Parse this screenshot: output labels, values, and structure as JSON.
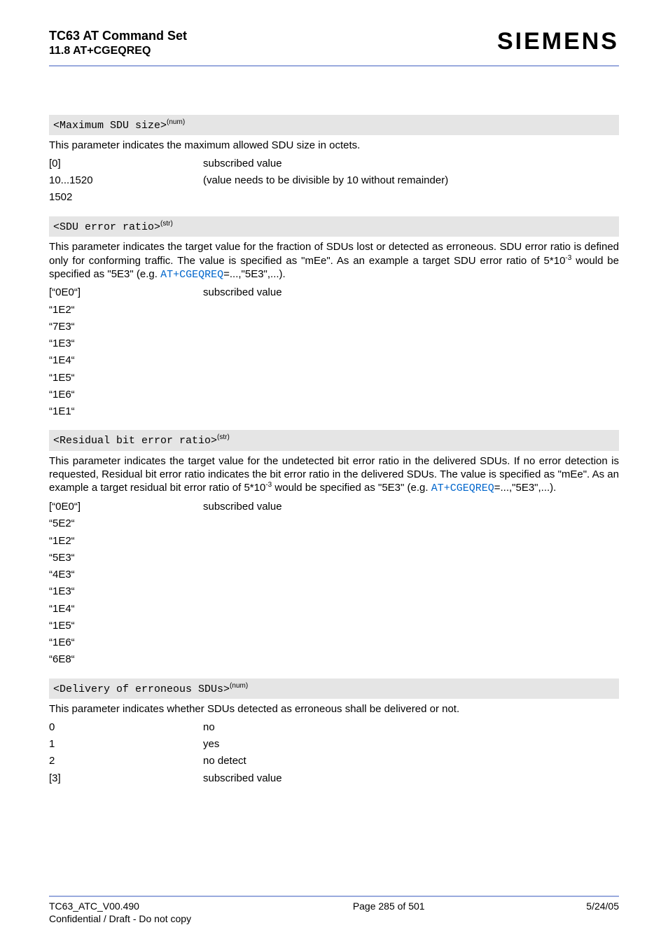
{
  "header": {
    "title": "TC63 AT Command Set",
    "section": "11.8 AT+CGEQREQ",
    "brand": "SIEMENS"
  },
  "sections": [
    {
      "param_html": "<span class=\"mono\">&lt;Maximum SDU size&gt;</span><sup>(num)</sup>",
      "desc_html": "This parameter indicates the maximum allowed SDU size in octets.",
      "rows": [
        {
          "k": "[0]",
          "v": "subscribed value"
        },
        {
          "k": "10...1520",
          "v": "(value needs to be divisible by 10 without remainder)"
        },
        {
          "k": "1502",
          "v": ""
        }
      ]
    },
    {
      "param_html": "<span class=\"mono\">&lt;SDU error ratio&gt;</span><sup>(str)</sup>",
      "desc_html": "This parameter indicates the target value for the fraction of SDUs lost or detected as erroneous. SDU error ratio is defined only for conforming traffic. The value is specified as \"mEe\". As an example a target SDU error ratio of 5*10<sup>-3</sup> would be specified as \"5E3\" (e.g. <span class=\"xref\">AT+CGEQREQ</span>=...,\"5E3\",...).",
      "rows": [
        {
          "k": "[“0E0“]",
          "v": "subscribed value"
        },
        {
          "k": "“1E2“",
          "v": ""
        },
        {
          "k": "“7E3“",
          "v": ""
        },
        {
          "k": "“1E3“",
          "v": ""
        },
        {
          "k": "“1E4“",
          "v": ""
        },
        {
          "k": "“1E5“",
          "v": ""
        },
        {
          "k": "“1E6“",
          "v": ""
        },
        {
          "k": "“1E1“",
          "v": ""
        }
      ]
    },
    {
      "param_html": "<span class=\"mono\">&lt;Residual bit error ratio&gt;</span><sup>(str)</sup>",
      "desc_html": "This parameter indicates the target value for the undetected bit error ratio in the delivered SDUs. If no error detection is requested, Residual bit error ratio indicates the bit error ratio in the delivered SDUs. The value is specified as \"mEe\". As an example a target residual bit error ratio of 5*10<sup>-3</sup> would be specified as \"5E3\" (e.g. <span class=\"xref\">AT+CGEQREQ</span>=...,\"5E3\",...).",
      "rows": [
        {
          "k": "[“0E0“]",
          "v": "subscribed value"
        },
        {
          "k": "“5E2“",
          "v": ""
        },
        {
          "k": "“1E2“",
          "v": ""
        },
        {
          "k": "“5E3“",
          "v": ""
        },
        {
          "k": "“4E3“",
          "v": ""
        },
        {
          "k": "“1E3“",
          "v": ""
        },
        {
          "k": "“1E4“",
          "v": ""
        },
        {
          "k": "“1E5“",
          "v": ""
        },
        {
          "k": "“1E6“",
          "v": ""
        },
        {
          "k": "“6E8“",
          "v": ""
        }
      ]
    },
    {
      "param_html": "<span class=\"mono\">&lt;Delivery of erroneous SDUs&gt;</span><sup>(num)</sup>",
      "desc_html": "This parameter indicates whether SDUs detected as erroneous shall be delivered or not.",
      "rows": [
        {
          "k": "0",
          "v": "no"
        },
        {
          "k": "1",
          "v": "yes"
        },
        {
          "k": "2",
          "v": "no detect"
        },
        {
          "k": "[3]",
          "v": "subscribed value"
        }
      ]
    }
  ],
  "footer": {
    "doc_id": "TC63_ATC_V00.490",
    "confidential": "Confidential / Draft - Do not copy",
    "page": "Page 285 of 501",
    "date": "5/24/05"
  }
}
